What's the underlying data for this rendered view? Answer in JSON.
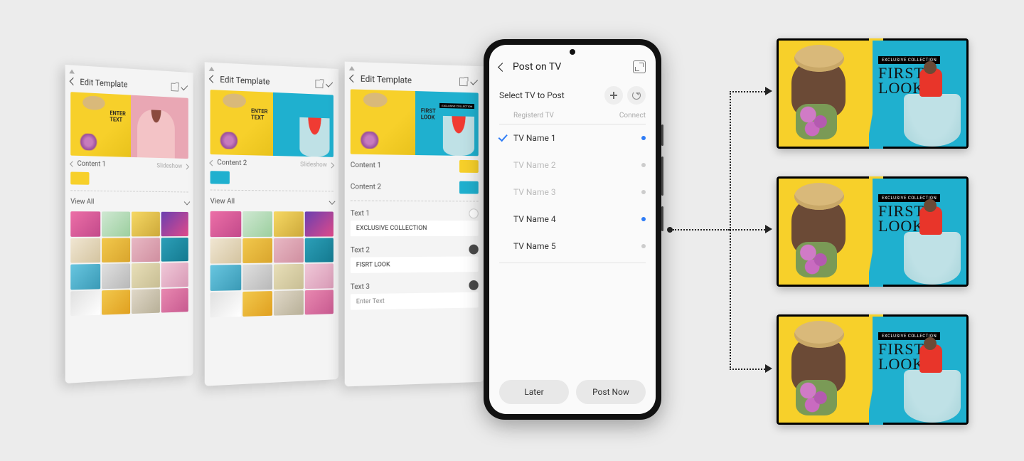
{
  "editor": {
    "title": "Edit Template",
    "slideshow_label": "Slideshow",
    "view_all_label": "View All",
    "content_labels": [
      "Content 1",
      "Content 2"
    ],
    "preview_text_enter": "ENTER\nTEXT",
    "preview_text_first": "FIRST\nLOOK",
    "preview_badge": "EXCLUSIVE COLLECTION",
    "text_fields": [
      {
        "label": "Text 1",
        "value": "EXCLUSIVE COLLECTION",
        "color": "white"
      },
      {
        "label": "Text 2",
        "value": "FISRT LOOK",
        "color": "dark"
      },
      {
        "label": "Text 3",
        "value": "Enter Text",
        "placeholder": true,
        "color": "dark"
      }
    ]
  },
  "post": {
    "title": "Post on TV",
    "select_label": "Select TV to Post",
    "col_registered": "Registerd TV",
    "col_connect": "Connect",
    "items": [
      {
        "name": "TV Name 1",
        "checked": true,
        "connected": true,
        "dim": false
      },
      {
        "name": "TV Name 2",
        "checked": false,
        "connected": false,
        "dim": true
      },
      {
        "name": "TV Name 3",
        "checked": false,
        "connected": false,
        "dim": true
      },
      {
        "name": "TV Name 4",
        "checked": false,
        "connected": true,
        "dim": false
      },
      {
        "name": "TV Name 5",
        "checked": false,
        "connected": false,
        "dim": false
      }
    ],
    "later": "Later",
    "post_now": "Post Now"
  },
  "tv_display": {
    "badge": "EXCLUSIVE COLLECTION",
    "headline": "FIRST\nLOOK"
  }
}
